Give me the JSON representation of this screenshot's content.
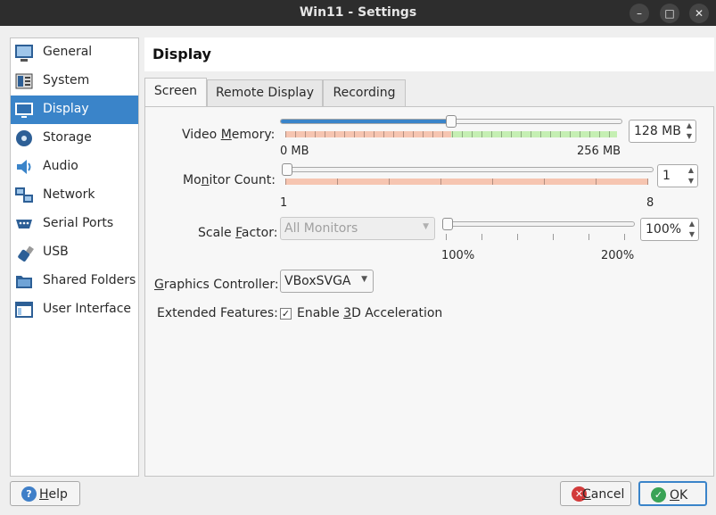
{
  "window": {
    "title": "Win11 - Settings",
    "controls": {
      "minimize": "–",
      "maximize": "□",
      "close": "✕"
    }
  },
  "sidebar": {
    "items": [
      {
        "label": "General",
        "icon": "monitor-icon"
      },
      {
        "label": "System",
        "icon": "chip-icon"
      },
      {
        "label": "Display",
        "icon": "display-icon",
        "selected": true
      },
      {
        "label": "Storage",
        "icon": "disk-icon"
      },
      {
        "label": "Audio",
        "icon": "speaker-icon"
      },
      {
        "label": "Network",
        "icon": "network-icon"
      },
      {
        "label": "Serial Ports",
        "icon": "serial-port-icon"
      },
      {
        "label": "USB",
        "icon": "usb-icon"
      },
      {
        "label": "Shared Folders",
        "icon": "folder-icon"
      },
      {
        "label": "User Interface",
        "icon": "window-icon"
      }
    ]
  },
  "page": {
    "title": "Display"
  },
  "tabs": [
    {
      "label": "Screen",
      "active": true
    },
    {
      "label": "Remote Display",
      "active": false
    },
    {
      "label": "Recording",
      "active": false
    }
  ],
  "screen": {
    "video_memory": {
      "label_pre": "Video ",
      "label_mnemonic": "M",
      "label_post": "emory:",
      "value": "128 MB",
      "min_label": "0 MB",
      "max_label": "256 MB",
      "level": 0.5
    },
    "monitor_count": {
      "label_pre": "Mo",
      "label_mnemonic": "n",
      "label_post": "itor Count:",
      "value": "1",
      "min_label": "1",
      "max_label": "8",
      "level": 0.0
    },
    "scale_factor": {
      "label_pre": "Scale ",
      "label_mnemonic": "F",
      "label_post": "actor:",
      "monitor_select": "All Monitors",
      "value": "100%",
      "min_label": "100%",
      "max_label": "200%",
      "level": 0.0
    },
    "graphics_controller": {
      "label_pre": "",
      "label_mnemonic": "G",
      "label_post": "raphics Controller:",
      "value": "VBoxSVGA"
    },
    "extended_features": {
      "label": "Extended Features:",
      "checkbox_pre": "Enable ",
      "checkbox_mnemonic": "3",
      "checkbox_post": "D Acceleration",
      "checked": true,
      "check_glyph": "✓"
    }
  },
  "buttons": {
    "help": {
      "mnemonic": "H",
      "rest": "elp",
      "icon_glyph": "?",
      "color": "#3f7fc8"
    },
    "cancel": {
      "mnemonic": "C",
      "rest": "ancel",
      "icon_glyph": "✕",
      "color": "#d23b3b"
    },
    "ok": {
      "mnemonic": "O",
      "rest": "K",
      "icon_glyph": "✓",
      "color": "#3aa356"
    }
  },
  "colors": {
    "accent": "#3a84c9",
    "titlebar": "#2d2d2d"
  }
}
